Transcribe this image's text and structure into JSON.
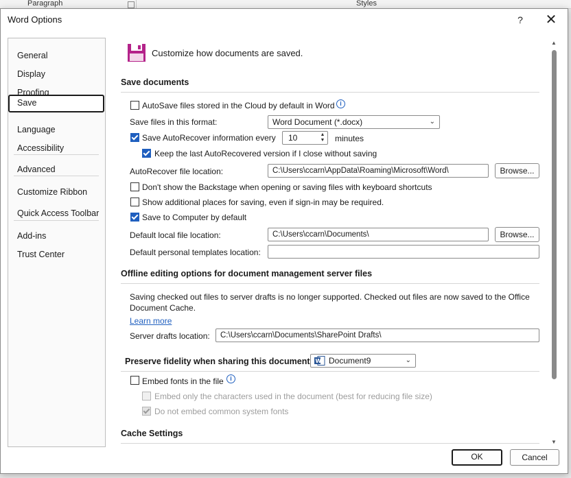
{
  "background": {
    "paragraph_label": "Paragraph",
    "styles_label": "Styles"
  },
  "window": {
    "title": "Word Options",
    "help_label": "?",
    "close_label": "✕"
  },
  "nav": {
    "items": [
      {
        "label": "General"
      },
      {
        "label": "Display"
      },
      {
        "label": "Proofing"
      },
      {
        "label": "Save",
        "selected": true
      },
      {
        "label": "Language"
      },
      {
        "label": "Accessibility"
      },
      {
        "label": "Advanced"
      },
      {
        "label": "Customize Ribbon"
      },
      {
        "label": "Quick Access Toolbar"
      },
      {
        "label": "Add-ins"
      },
      {
        "label": "Trust Center"
      }
    ]
  },
  "header": {
    "text": "Customize how documents are saved.",
    "icon": "floppy-disk-icon"
  },
  "save_documents": {
    "title": "Save documents",
    "autosave_label": "AutoSave files stored in the Cloud by default in Word",
    "autosave_checked": false,
    "format_label": "Save files in this format:",
    "format_value": "Word Document (*.docx)",
    "autorecover_label": "Save AutoRecover information every",
    "autorecover_checked": true,
    "autorecover_minutes": "10",
    "minutes_label": "minutes",
    "keep_label": "Keep the last AutoRecovered version if I close without saving",
    "keep_checked": true,
    "ar_location_label": "AutoRecover file location:",
    "ar_location_value": "C:\\Users\\ccarn\\AppData\\Roaming\\Microsoft\\Word\\",
    "browse_label": "Browse...",
    "backstage_label": "Don't show the Backstage when opening or saving files with keyboard shortcuts",
    "backstage_checked": false,
    "additional_label": "Show additional places for saving, even if sign-in may be required.",
    "additional_checked": false,
    "computer_label": "Save to Computer by default",
    "computer_checked": true,
    "local_label": "Default local file location:",
    "local_value": "C:\\Users\\ccarn\\Documents\\",
    "browse2_label": "Browse...",
    "templates_label": "Default personal templates location:",
    "templates_value": ""
  },
  "offline": {
    "title": "Offline editing options for document management server files",
    "paragraph": "Saving checked out files to server drafts is no longer supported. Checked out files are now saved to the Office Document Cache.",
    "learn_more": "Learn more",
    "server_label": "Server drafts location:",
    "server_value": "C:\\Users\\ccarn\\Documents\\SharePoint Drafts\\"
  },
  "fidelity": {
    "title": "Preserve fidelity when sharing this document:",
    "document_value": "Document9",
    "embed_label": "Embed fonts in the file",
    "embed_checked": false,
    "embed_only_label": "Embed only the characters used in the document (best for reducing file size)",
    "embed_only_checked": false,
    "no_common_label": "Do not embed common system fonts",
    "no_common_checked": true
  },
  "cache": {
    "title": "Cache Settings"
  },
  "footer": {
    "ok_label": "OK",
    "cancel_label": "Cancel"
  },
  "colors": {
    "accent": "#1f5fbf",
    "floppy": "#b4238a"
  }
}
